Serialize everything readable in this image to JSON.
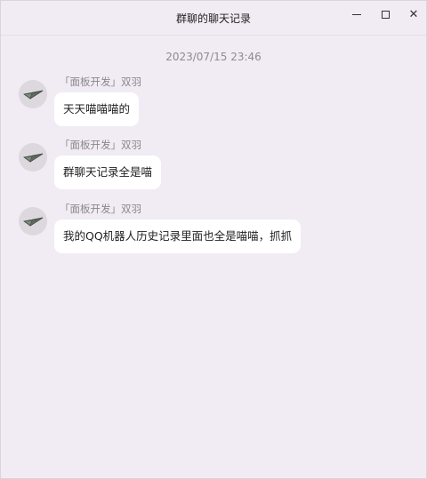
{
  "window": {
    "title": "群聊的聊天记录",
    "controls": {
      "minimize_icon": "minimize-icon",
      "maximize_icon": "maximize-icon",
      "close_icon": "close-icon",
      "close_glyph": "✕"
    }
  },
  "chat": {
    "timestamp": "2023/07/15 23:46",
    "messages": [
      {
        "sender": "「面板开发」双羽",
        "avatar_icon": "paper-plane-icon",
        "text": "天天喵喵喵的"
      },
      {
        "sender": "「面板开发」双羽",
        "avatar_icon": "paper-plane-icon",
        "text": "群聊天记录全是喵"
      },
      {
        "sender": "「面板开发」双羽",
        "avatar_icon": "paper-plane-icon",
        "text": "我的QQ机器人历史记录里面也全是喵喵，抓抓"
      }
    ]
  },
  "colors": {
    "background": "#f1ecf3",
    "bubble": "#ffffff",
    "sender_text": "#8b878f",
    "timestamp_text": "#8e8a92"
  }
}
